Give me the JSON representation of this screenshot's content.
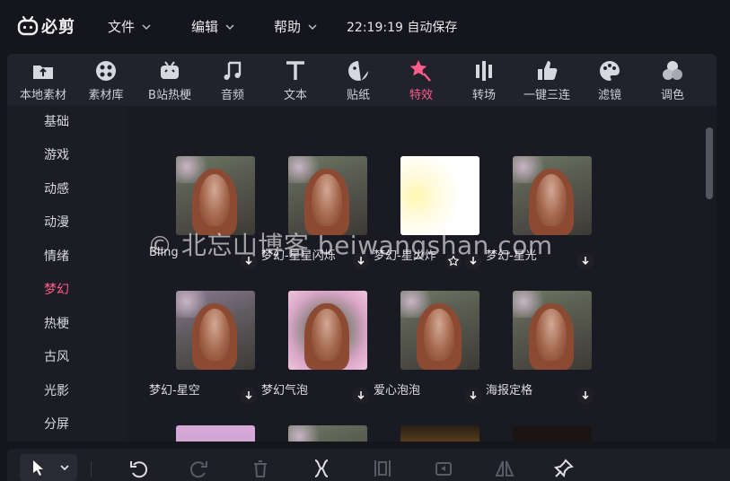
{
  "app": {
    "name": "必剪"
  },
  "menu": [
    {
      "label": "文件"
    },
    {
      "label": "编辑"
    },
    {
      "label": "帮助"
    }
  ],
  "autosave": "22:19:19 自动保存",
  "tabs": [
    {
      "label": "本地素材",
      "icon": "upload-folder-icon"
    },
    {
      "label": "素材库",
      "icon": "film-reel-icon"
    },
    {
      "label": "B站热梗",
      "icon": "tv-mascot-icon"
    },
    {
      "label": "音频",
      "icon": "music-note-icon"
    },
    {
      "label": "文本",
      "icon": "text-icon"
    },
    {
      "label": "贴纸",
      "icon": "sticker-icon"
    },
    {
      "label": "特效",
      "icon": "star-wand-icon",
      "active": true
    },
    {
      "label": "转场",
      "icon": "transition-icon"
    },
    {
      "label": "一键三连",
      "icon": "thumbs-up-icon"
    },
    {
      "label": "滤镜",
      "icon": "palette-icon"
    },
    {
      "label": "调色",
      "icon": "color-circles-icon"
    }
  ],
  "sidebar": {
    "items": [
      {
        "label": "基础"
      },
      {
        "label": "游戏"
      },
      {
        "label": "动感"
      },
      {
        "label": "动漫"
      },
      {
        "label": "情绪"
      },
      {
        "label": "梦幻",
        "active": true
      },
      {
        "label": "热梗"
      },
      {
        "label": "古风"
      },
      {
        "label": "光影"
      },
      {
        "label": "分屏"
      }
    ]
  },
  "effects": [
    {
      "name": "Bling"
    },
    {
      "name": "梦幻-星星闪烁"
    },
    {
      "name": "梦幻-星火炸"
    },
    {
      "name": "梦幻-星光"
    },
    {
      "name": "梦幻-星空"
    },
    {
      "name": "梦幻气泡"
    },
    {
      "name": "爱心泡泡"
    },
    {
      "name": "海报定格"
    }
  ],
  "watermark": "© 北忘山博客 beiwangshan.com",
  "colors": {
    "accent": "#ff5c8a",
    "background": "#15151c",
    "panel": "#20202a",
    "text": "#e6e6ea"
  }
}
